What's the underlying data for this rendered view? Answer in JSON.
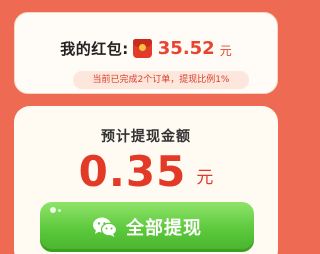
{
  "red_packet": {
    "label": "我的红包:",
    "amount": "35.52",
    "unit": "元",
    "icon": "red-packet-icon"
  },
  "progress_text": "当前已完成2个订单，提现比例1%",
  "estimate": {
    "label": "预计提现金额",
    "amount": "0.35",
    "unit": "元"
  },
  "withdraw_button": {
    "label": "全部提现",
    "icon": "wechat-icon"
  },
  "colors": {
    "background": "#ee6a52",
    "accent_red": "#e23a27",
    "button_green": "#5cc83c"
  }
}
